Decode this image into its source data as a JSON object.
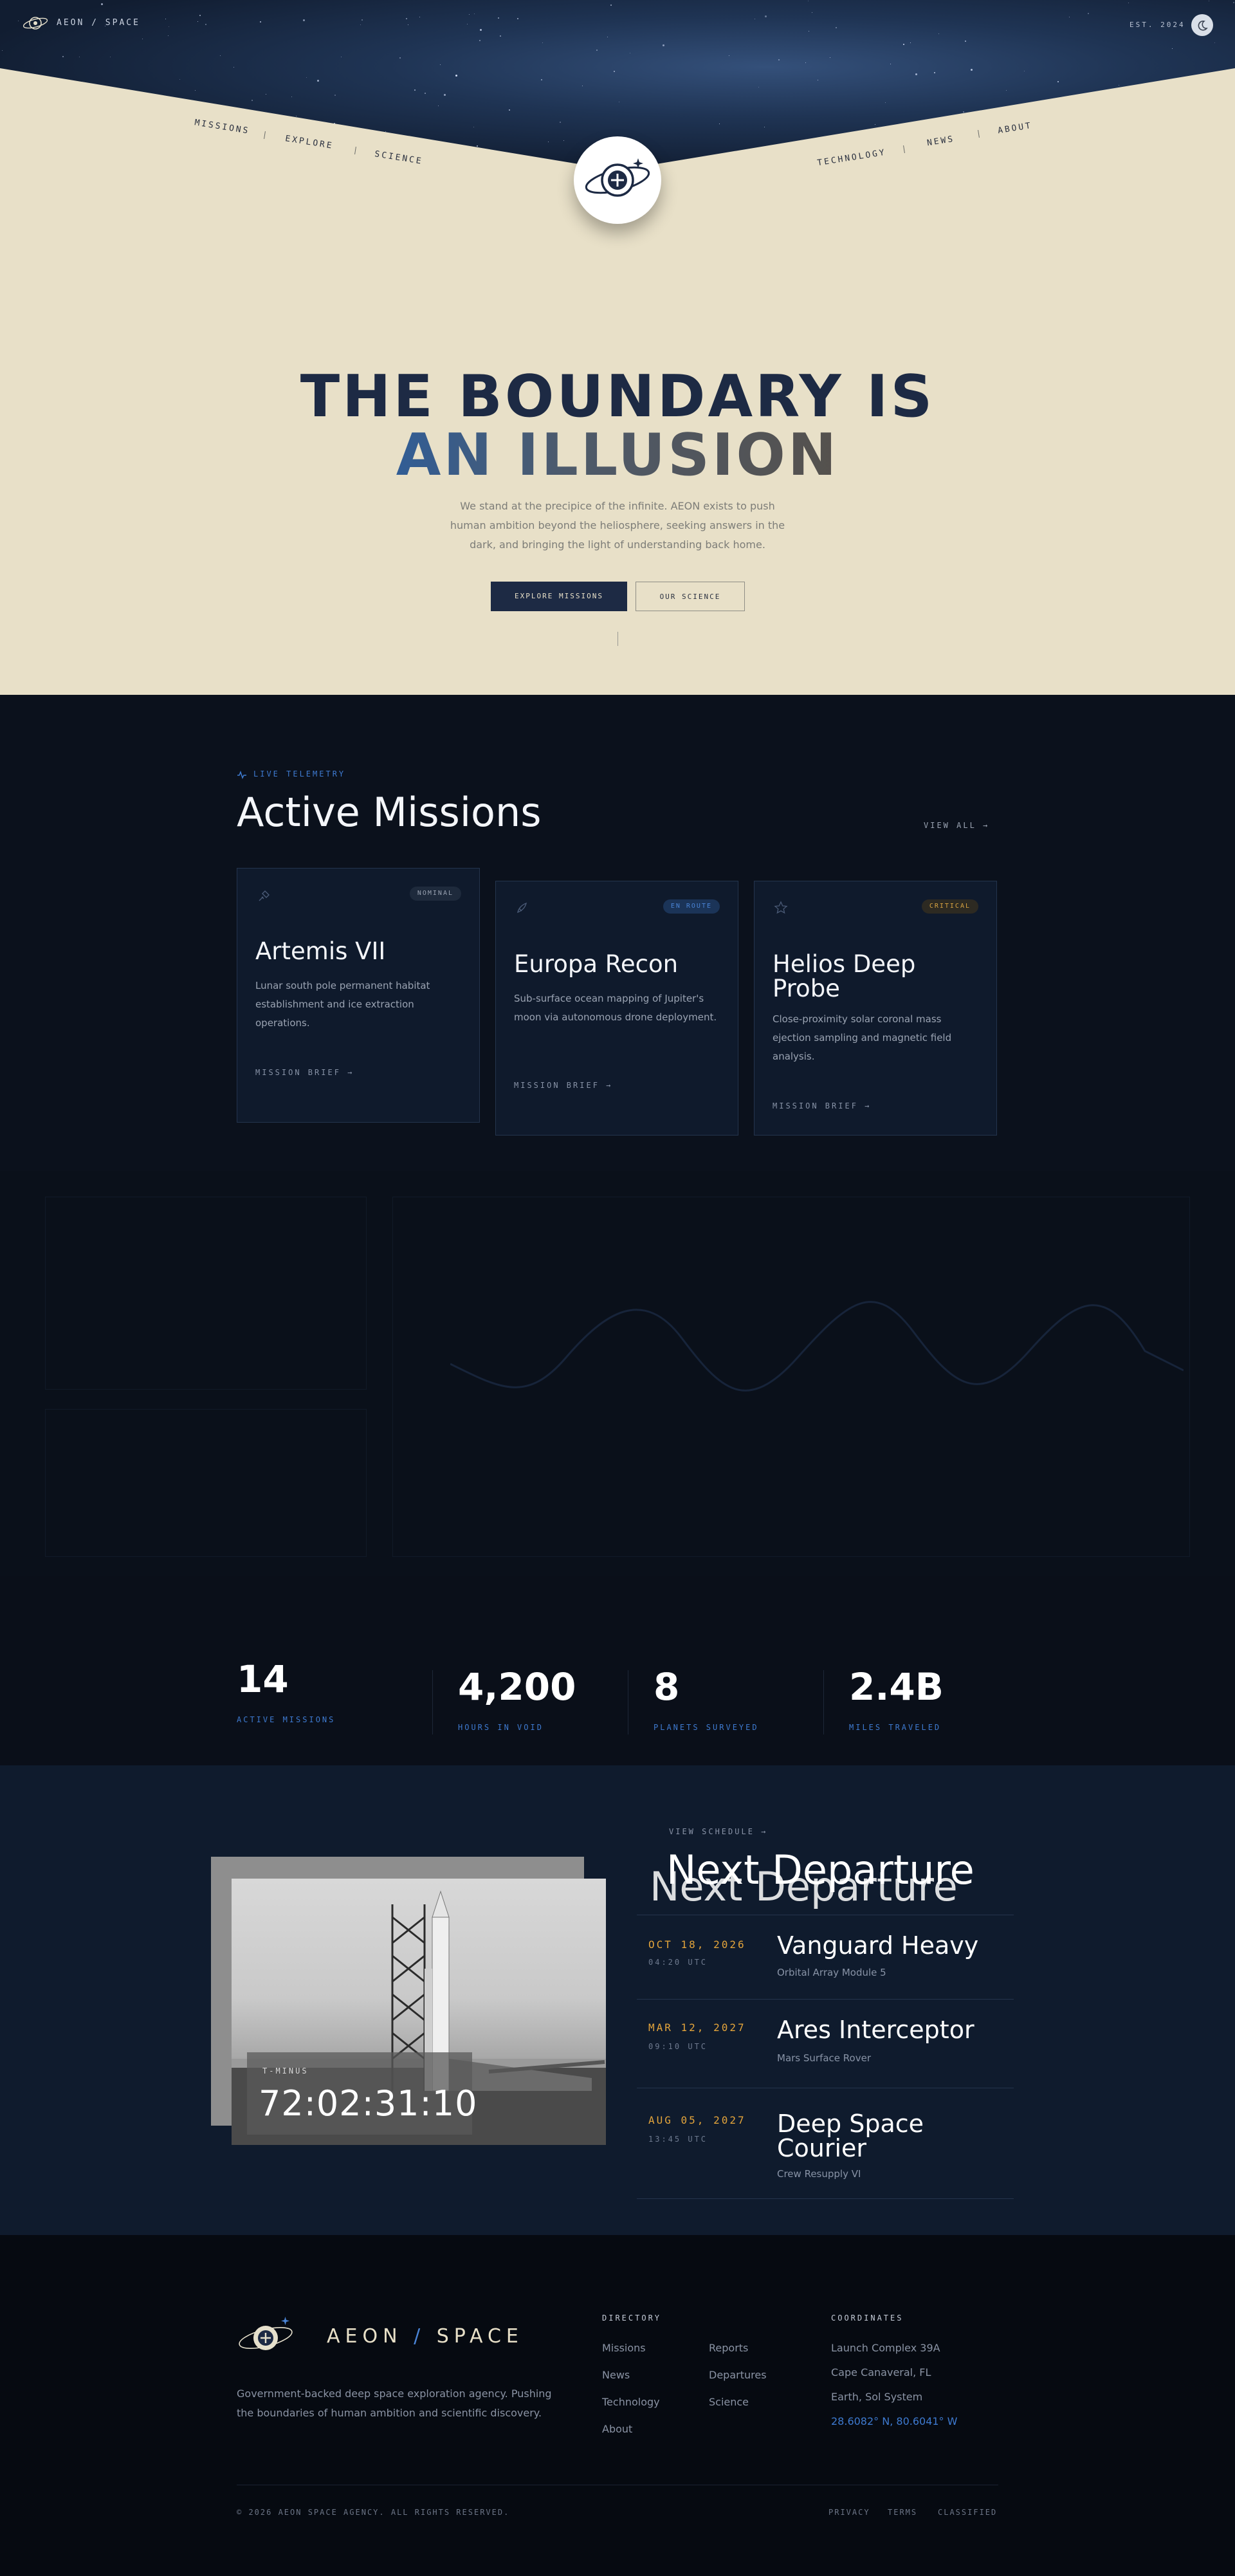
{
  "header": {
    "brand": "AEON / SPACE",
    "est": "EST. 2024",
    "nav_left": [
      "MISSIONS",
      "EXPLORE",
      "SCIENCE"
    ],
    "nav_right": [
      "TECHNOLOGY",
      "NEWS",
      "ABOUT"
    ],
    "theme_icon": "moon-icon",
    "logo_icon": "orbit-logo-icon"
  },
  "hero": {
    "title_line1": "THE BOUNDARY IS",
    "title_line2": "AN ILLUSION",
    "paragraph": "We stand at the precipice of the infinite. AEON exists to push human ambition beyond the heliosphere, seeking answers in the dark, and bringing the light of understanding back home.",
    "primary_button": "EXPLORE MISSIONS",
    "secondary_button": "OUR SCIENCE"
  },
  "missions": {
    "eyebrow": "LIVE TELEMETRY",
    "title": "Active Missions",
    "view_all": "VIEW ALL",
    "cards": [
      {
        "badge": "NOMINAL",
        "badge_color": "#9aa3b2",
        "title": "Artemis VII",
        "description": "Lunar south pole permanent habitat establishment and ice extraction operations.",
        "link": "MISSION BRIEF",
        "icon": "satellite-icon"
      },
      {
        "badge": "EN ROUTE",
        "badge_color": "#4a84d6",
        "title": "Europa Recon",
        "description": "Sub-surface ocean mapping of Jupiter's moon via autonomous drone deployment.",
        "link": "MISSION BRIEF",
        "icon": "rocket-icon"
      },
      {
        "badge": "CRITICAL",
        "badge_color": "#d9a441",
        "title": "Helios Deep Probe",
        "description": "Close-proximity solar coronal mass ejection sampling and magnetic field analysis.",
        "link": "MISSION BRIEF",
        "icon": "star-icon"
      }
    ]
  },
  "stats": [
    {
      "value": "14",
      "label": "ACTIVE MISSIONS"
    },
    {
      "value": "4,200",
      "label": "HOURS IN VOID"
    },
    {
      "value": "8",
      "label": "PLANETS SURVEYED"
    },
    {
      "value": "2.4B",
      "label": "MILES TRAVELED"
    }
  ],
  "departures": {
    "view_schedule": "VIEW SCHEDULE",
    "title": "Next Departure",
    "countdown_label": "T-MINUS",
    "countdown": "72:02:31:10",
    "items": [
      {
        "date": "OCT 18, 2026",
        "time": "04:20 UTC",
        "name": "Vanguard Heavy",
        "payload": "Orbital Array Module 5"
      },
      {
        "date": "MAR 12, 2027",
        "time": "09:10 UTC",
        "name": "Ares Interceptor",
        "payload": "Mars Surface Rover"
      },
      {
        "date": "AUG 05, 2027",
        "time": "13:45 UTC",
        "name": "Deep Space Courier",
        "payload": "Crew Resupply VI"
      }
    ]
  },
  "footer": {
    "brand_left": "AEON",
    "brand_slash": "/",
    "brand_right": "SPACE",
    "description": "Government-backed deep space exploration agency. Pushing the boundaries of human ambition and scientific discovery.",
    "directory_title": "DIRECTORY",
    "directory_col1": [
      "Missions",
      "News",
      "Technology",
      "About"
    ],
    "directory_col2": [
      "Reports",
      "Departures",
      "Science"
    ],
    "coordinates_title": "COORDINATES",
    "coordinates": [
      "Launch Complex 39A",
      "Cape Canaveral, FL",
      "Earth, Sol System"
    ],
    "coordinates_link": "28.6082° N, 80.6041° W",
    "copyright": "© 2026 AEON SPACE AGENCY. ALL RIGHTS RESERVED.",
    "legal": [
      "PRIVACY",
      "TERMS",
      "CLASSIFIED"
    ]
  },
  "colors": {
    "navy": "#1d2a44",
    "accent_blue": "#3e7ad0",
    "amber": "#e3a43b",
    "sand": "#e8e0c8"
  }
}
